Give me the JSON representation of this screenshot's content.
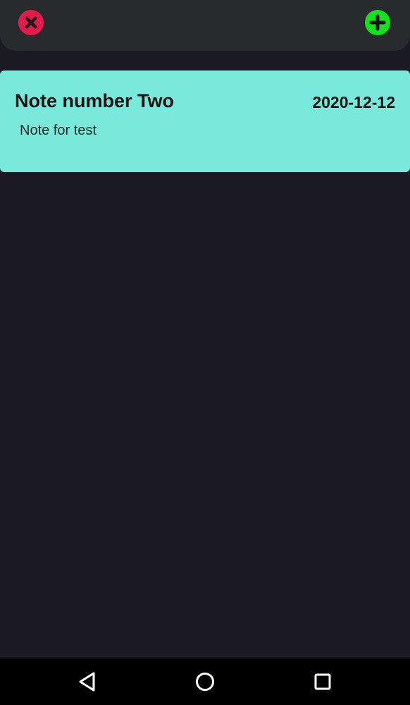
{
  "colors": {
    "background": "#1c1a24",
    "topbar": "#292a2e",
    "close_button": "#e41b4a",
    "add_button": "#12e21e",
    "note_card": "#78e9db",
    "navbar": "#000000"
  },
  "toolbar": {
    "close_icon": "close-icon",
    "add_icon": "plus-icon"
  },
  "notes": [
    {
      "title": "Note number Two",
      "date": "2020-12-12",
      "body": "Note for test"
    }
  ],
  "system_nav": {
    "back_icon": "back-triangle-icon",
    "home_icon": "home-circle-icon",
    "recents_icon": "recents-square-icon"
  }
}
